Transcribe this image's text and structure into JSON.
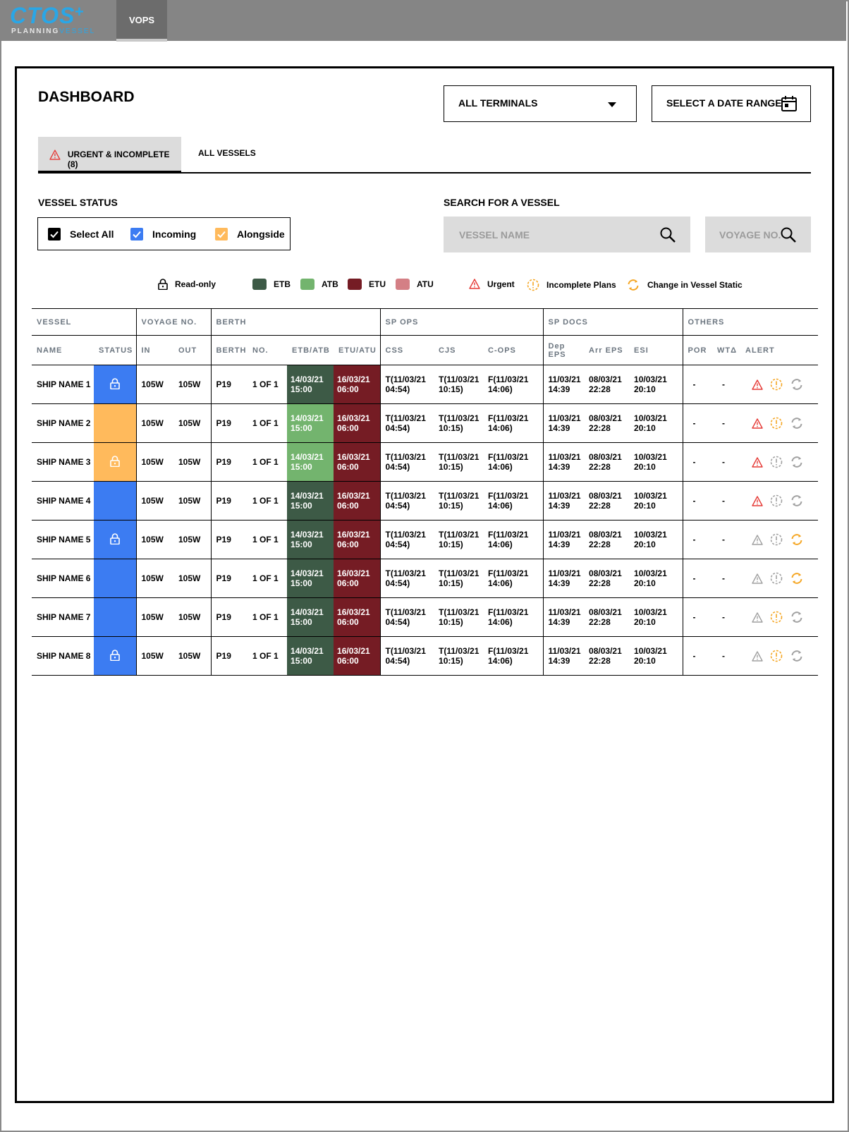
{
  "app": {
    "logo_word": "CTOS",
    "logo_plus": "+",
    "logo_sub_planning": "PLANNING",
    "logo_sub_vessel": "VESSEL",
    "nav_tab": "VOPS"
  },
  "page_title": "DASHBOARD",
  "filters": {
    "terminals": "ALL TERMINALS",
    "date_range": "SELECT A DATE RANGE"
  },
  "tabs": {
    "urgent": "URGENT & INCOMPLETE (8)",
    "all": "ALL VESSELS"
  },
  "vessel_status": {
    "label": "VESSEL STATUS",
    "select_all": "Select All",
    "incoming": "Incoming",
    "alongside": "Alongside"
  },
  "search": {
    "label": "SEARCH FOR A VESSEL",
    "vessel_placeholder": "VESSEL NAME",
    "voyage_placeholder": "VOYAGE NO."
  },
  "legend": {
    "readonly": "Read-only",
    "etb": "ETB",
    "atb": "ATB",
    "etu": "ETU",
    "atu": "ATU",
    "urgent": "Urgent",
    "incomplete": "Incomplete Plans",
    "change": "Change in Vessel Static"
  },
  "colors": {
    "incoming": "#3c7cf2",
    "alongside": "#ffba5c",
    "etb": "#3d5a46",
    "atb": "#73b46e",
    "etu": "#751c24",
    "atu": "#d47f85",
    "urgent": "#e53935",
    "incomplete": "#f5a623",
    "inactive": "#a0a0a0"
  },
  "table": {
    "groups": {
      "vessel": "VESSEL",
      "voyage": "VOYAGE NO.",
      "berth": "BERTH",
      "sp_ops": "SP OPS",
      "sp_docs": "SP DOCS",
      "others": "OTHERS"
    },
    "columns": {
      "name": "NAME",
      "status": "STATUS",
      "in": "IN",
      "out": "OUT",
      "berth": "BERTH",
      "no": "NO.",
      "etb_atb": "ETB/ATB",
      "etu_atu": "ETU/ATU",
      "css": "CSS",
      "cjs": "CJS",
      "cops": "C-OPS",
      "dep_eps": "Dep EPS",
      "arr_eps": "Arr EPS",
      "esi": "ESI",
      "por": "POR",
      "wta": "WTΔ",
      "alert": "ALERT"
    },
    "rows": [
      {
        "name": "SHIP NAME 1",
        "status": "incoming",
        "locked": true,
        "in": "105W",
        "out": "105W",
        "berth": "P19",
        "no": "1 OF 1",
        "etb_type": "etb",
        "etb_date": "14/03/21",
        "etb_time": "15:00",
        "etu_date": "16/03/21",
        "etu_time": "06:00",
        "css_a": "T(11/03/21",
        "css_b": "04:54)",
        "cjs_a": "T(11/03/21",
        "cjs_b": "10:15)",
        "cops_a": "F(11/03/21",
        "cops_b": "14:06)",
        "dep_a": "11/03/21",
        "dep_b": "14:39",
        "arr_a": "08/03/21",
        "arr_b": "22:28",
        "esi_a": "10/03/21",
        "esi_b": "20:10",
        "por": "-",
        "wta": "-",
        "urgent": true,
        "incomplete": true,
        "change": false
      },
      {
        "name": "SHIP NAME 2",
        "status": "alongside",
        "locked": false,
        "in": "105W",
        "out": "105W",
        "berth": "P19",
        "no": "1 OF 1",
        "etb_type": "atb",
        "etb_date": "14/03/21",
        "etb_time": "15:00",
        "etu_date": "16/03/21",
        "etu_time": "06:00",
        "css_a": "T(11/03/21",
        "css_b": "04:54)",
        "cjs_a": "T(11/03/21",
        "cjs_b": "10:15)",
        "cops_a": "F(11/03/21",
        "cops_b": "14:06)",
        "dep_a": "11/03/21",
        "dep_b": "14:39",
        "arr_a": "08/03/21",
        "arr_b": "22:28",
        "esi_a": "10/03/21",
        "esi_b": "20:10",
        "por": "-",
        "wta": "-",
        "urgent": true,
        "incomplete": true,
        "change": false
      },
      {
        "name": "SHIP NAME 3",
        "status": "alongside",
        "locked": true,
        "in": "105W",
        "out": "105W",
        "berth": "P19",
        "no": "1 OF 1",
        "etb_type": "atb",
        "etb_date": "14/03/21",
        "etb_time": "15:00",
        "etu_date": "16/03/21",
        "etu_time": "06:00",
        "css_a": "T(11/03/21",
        "css_b": "04:54)",
        "cjs_a": "T(11/03/21",
        "cjs_b": "10:15)",
        "cops_a": "F(11/03/21",
        "cops_b": "14:06)",
        "dep_a": "11/03/21",
        "dep_b": "14:39",
        "arr_a": "08/03/21",
        "arr_b": "22:28",
        "esi_a": "10/03/21",
        "esi_b": "20:10",
        "por": "-",
        "wta": "-",
        "urgent": true,
        "incomplete": false,
        "change": false
      },
      {
        "name": "SHIP NAME 4",
        "status": "incoming",
        "locked": false,
        "in": "105W",
        "out": "105W",
        "berth": "P19",
        "no": "1 OF 1",
        "etb_type": "etb",
        "etb_date": "14/03/21",
        "etb_time": "15:00",
        "etu_date": "16/03/21",
        "etu_time": "06:00",
        "css_a": "T(11/03/21",
        "css_b": "04:54)",
        "cjs_a": "T(11/03/21",
        "cjs_b": "10:15)",
        "cops_a": "F(11/03/21",
        "cops_b": "14:06)",
        "dep_a": "11/03/21",
        "dep_b": "14:39",
        "arr_a": "08/03/21",
        "arr_b": "22:28",
        "esi_a": "10/03/21",
        "esi_b": "20:10",
        "por": "-",
        "wta": "-",
        "urgent": true,
        "incomplete": false,
        "change": false
      },
      {
        "name": "SHIP NAME 5",
        "status": "incoming",
        "locked": true,
        "in": "105W",
        "out": "105W",
        "berth": "P19",
        "no": "1 OF 1",
        "etb_type": "etb",
        "etb_date": "14/03/21",
        "etb_time": "15:00",
        "etu_date": "16/03/21",
        "etu_time": "06:00",
        "css_a": "T(11/03/21",
        "css_b": "04:54)",
        "cjs_a": "T(11/03/21",
        "cjs_b": "10:15)",
        "cops_a": "F(11/03/21",
        "cops_b": "14:06)",
        "dep_a": "11/03/21",
        "dep_b": "14:39",
        "arr_a": "08/03/21",
        "arr_b": "22:28",
        "esi_a": "10/03/21",
        "esi_b": "20:10",
        "por": "-",
        "wta": "-",
        "urgent": false,
        "incomplete": false,
        "change": true
      },
      {
        "name": "SHIP NAME 6",
        "status": "incoming",
        "locked": false,
        "in": "105W",
        "out": "105W",
        "berth": "P19",
        "no": "1 OF 1",
        "etb_type": "etb",
        "etb_date": "14/03/21",
        "etb_time": "15:00",
        "etu_date": "16/03/21",
        "etu_time": "06:00",
        "css_a": "T(11/03/21",
        "css_b": "04:54)",
        "cjs_a": "T(11/03/21",
        "cjs_b": "10:15)",
        "cops_a": "F(11/03/21",
        "cops_b": "14:06)",
        "dep_a": "11/03/21",
        "dep_b": "14:39",
        "arr_a": "08/03/21",
        "arr_b": "22:28",
        "esi_a": "10/03/21",
        "esi_b": "20:10",
        "por": "-",
        "wta": "-",
        "urgent": false,
        "incomplete": false,
        "change": true
      },
      {
        "name": "SHIP NAME 7",
        "status": "incoming",
        "locked": false,
        "in": "105W",
        "out": "105W",
        "berth": "P19",
        "no": "1 OF 1",
        "etb_type": "etb",
        "etb_date": "14/03/21",
        "etb_time": "15:00",
        "etu_date": "16/03/21",
        "etu_time": "06:00",
        "css_a": "T(11/03/21",
        "css_b": "04:54)",
        "cjs_a": "T(11/03/21",
        "cjs_b": "10:15)",
        "cops_a": "F(11/03/21",
        "cops_b": "14:06)",
        "dep_a": "11/03/21",
        "dep_b": "14:39",
        "arr_a": "08/03/21",
        "arr_b": "22:28",
        "esi_a": "10/03/21",
        "esi_b": "20:10",
        "por": "-",
        "wta": "-",
        "urgent": false,
        "incomplete": true,
        "change": false
      },
      {
        "name": "SHIP NAME 8",
        "status": "incoming",
        "locked": true,
        "in": "105W",
        "out": "105W",
        "berth": "P19",
        "no": "1 OF 1",
        "etb_type": "etb",
        "etb_date": "14/03/21",
        "etb_time": "15:00",
        "etu_date": "16/03/21",
        "etu_time": "06:00",
        "css_a": "T(11/03/21",
        "css_b": "04:54)",
        "cjs_a": "T(11/03/21",
        "cjs_b": "10:15)",
        "cops_a": "F(11/03/21",
        "cops_b": "14:06)",
        "dep_a": "11/03/21",
        "dep_b": "14:39",
        "arr_a": "08/03/21",
        "arr_b": "22:28",
        "esi_a": "10/03/21",
        "esi_b": "20:10",
        "por": "-",
        "wta": "-",
        "urgent": false,
        "incomplete": true,
        "change": false
      }
    ]
  }
}
